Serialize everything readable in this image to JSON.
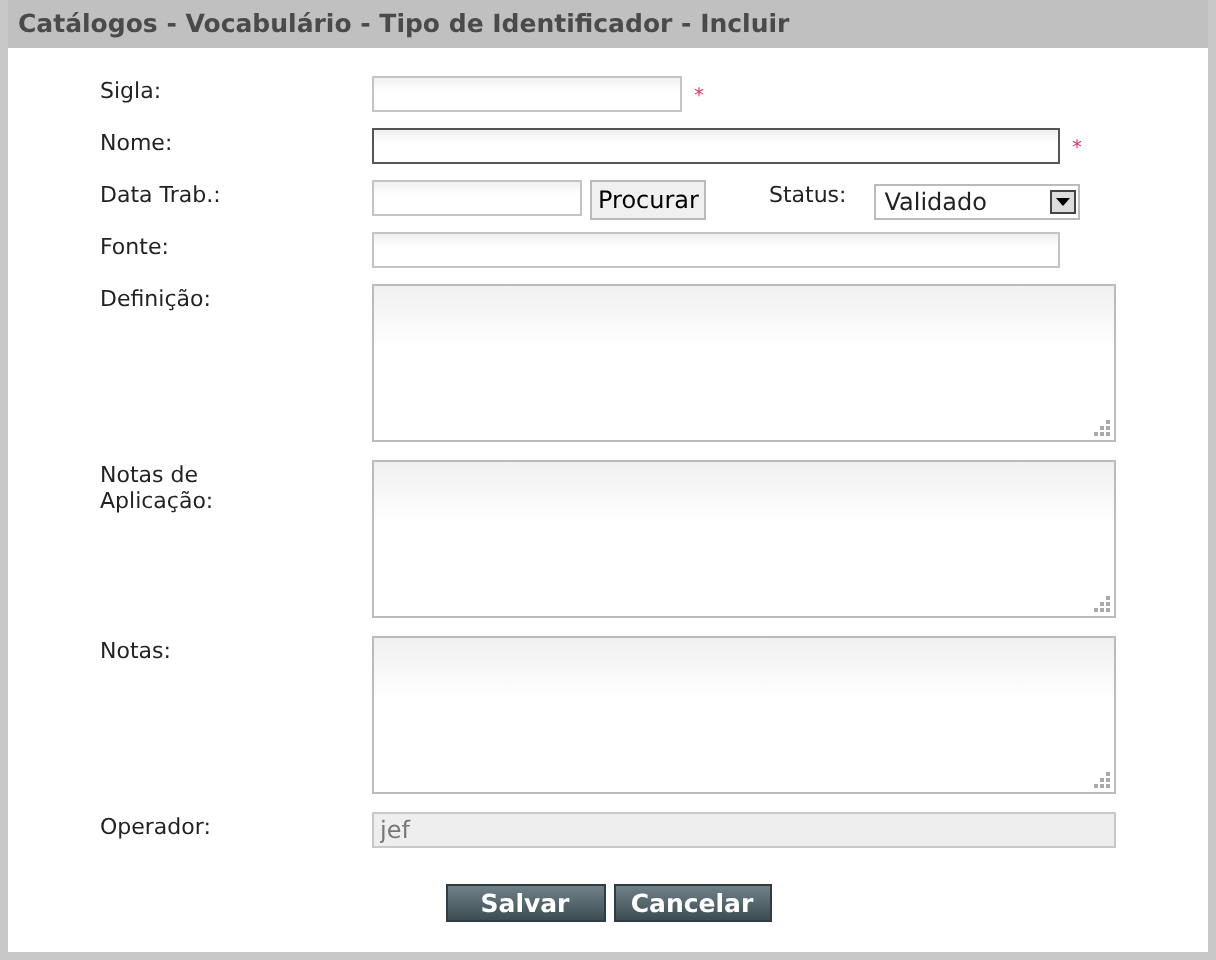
{
  "window": {
    "title": "Catálogos - Vocabulário - Tipo de Identificador - Incluir"
  },
  "fields": [
    {
      "kind": "short-text",
      "label": "Sigla:",
      "focused": false,
      "required_mark": "*"
    },
    {
      "kind": "text",
      "label": "Nome:",
      "focused": true,
      "required_mark": "*"
    },
    {
      "kind": "date-search",
      "label": "Data Trab.:",
      "button": "Procurar",
      "status_label": "Status:",
      "status_value": "Validado"
    },
    {
      "kind": "text",
      "label": "Fonte:",
      "focused": false
    },
    {
      "kind": "textarea",
      "label": "Definição:"
    },
    {
      "kind": "textarea",
      "label": "Notas de Aplicação:"
    },
    {
      "kind": "textarea",
      "label": "Notas:"
    },
    {
      "kind": "readonly",
      "label": "Operador:",
      "value": "jef"
    }
  ],
  "buttons": [
    "Salvar",
    "Cancelar"
  ]
}
